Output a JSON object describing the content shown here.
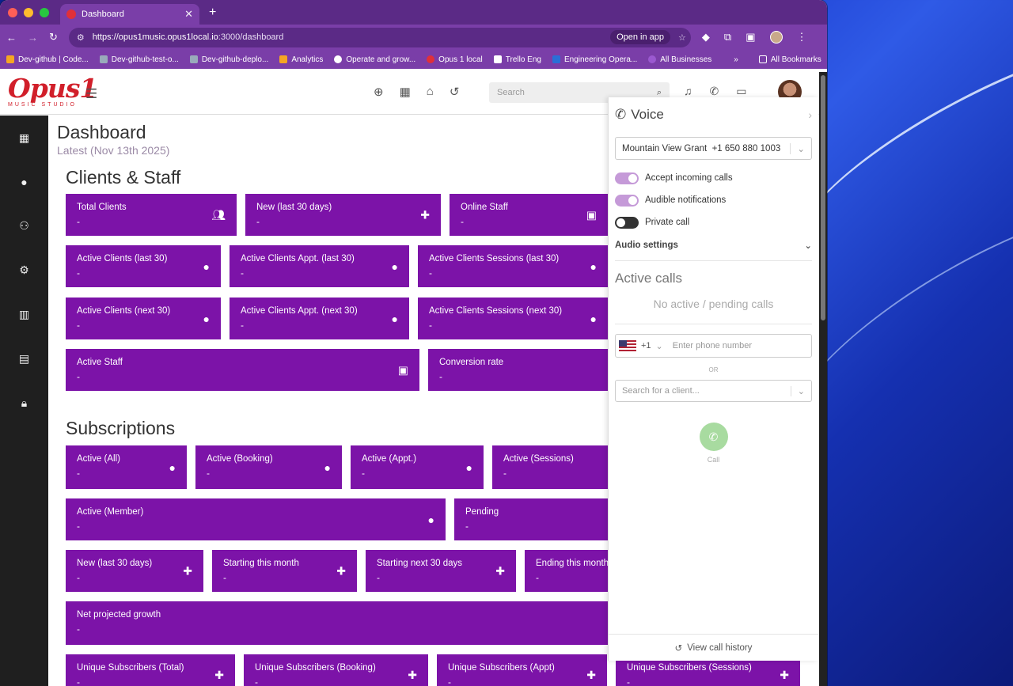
{
  "browser": {
    "tab_title": "Dashboard",
    "url_host": "https://opus1music.opus1local.io",
    "url_path": ":3000/dashboard",
    "open_in_app": "Open in app",
    "bookmarks": [
      "Dev-github | Code...",
      "Dev-github-test-o...",
      "Dev-github-deplo...",
      "Analytics",
      "Operate and grow...",
      "Opus 1 local",
      "Trello Eng",
      "Engineering Opera...",
      "All Businesses"
    ],
    "more": "»",
    "all_bookmarks": "All Bookmarks"
  },
  "header": {
    "logo_text": "Opus1",
    "logo_sub": "MUSIC STUDIO",
    "search_placeholder": "Search"
  },
  "dashboard": {
    "title": "Dashboard",
    "subtitle": "Latest (Nov 13th 2025)"
  },
  "sections": {
    "clients_staff": "Clients & Staff",
    "subscriptions": "Subscriptions"
  },
  "cards": {
    "total_clients": "Total Clients",
    "new_30": "New (last 30 days)",
    "online_staff": "Online Staff",
    "ac_last30": "Active Clients (last 30)",
    "aca_last30": "Active Clients Appt. (last 30)",
    "acs_last30": "Active Clients Sessions (last 30)",
    "ac_next30": "Active Clients (next 30)",
    "aca_next30": "Active Clients Appt. (next 30)",
    "acs_next30": "Active Clients Sessions (next 30)",
    "active_staff": "Active Staff",
    "conversion": "Conversion rate",
    "s_all": "Active (All)",
    "s_booking": "Active (Booking)",
    "s_appt": "Active (Appt.)",
    "s_sessions": "Active (Sessions)",
    "s_member": "Active (Member)",
    "s_pending": "Pending",
    "s_new30": "New (last 30 days)",
    "s_start_month": "Starting this month",
    "s_start_next": "Starting next 30 days",
    "s_ending": "Ending this month",
    "s_growth": "Net projected growth",
    "u_total": "Unique Subscribers (Total)",
    "u_booking": "Unique Subscribers (Booking)",
    "u_appt": "Unique Subscribers (Appt)",
    "u_sessions": "Unique Subscribers (Sessions)",
    "value": "-"
  },
  "voice": {
    "title": "Voice",
    "location": "Mountain View Grant",
    "number": "+1 650 880 1003",
    "accept": "Accept incoming calls",
    "audible": "Audible notifications",
    "private": "Private call",
    "audio_settings": "Audio settings",
    "active_calls": "Active calls",
    "no_calls": "No active / pending calls",
    "country_code": "+1",
    "phone_placeholder": "Enter phone number",
    "or": "OR",
    "client_placeholder": "Search for a client...",
    "call": "Call",
    "history": "View call history"
  },
  "colors": {
    "card": "#7c13a8",
    "chrome": "#7a3ea8",
    "sidebar": "#1f1f1f"
  }
}
